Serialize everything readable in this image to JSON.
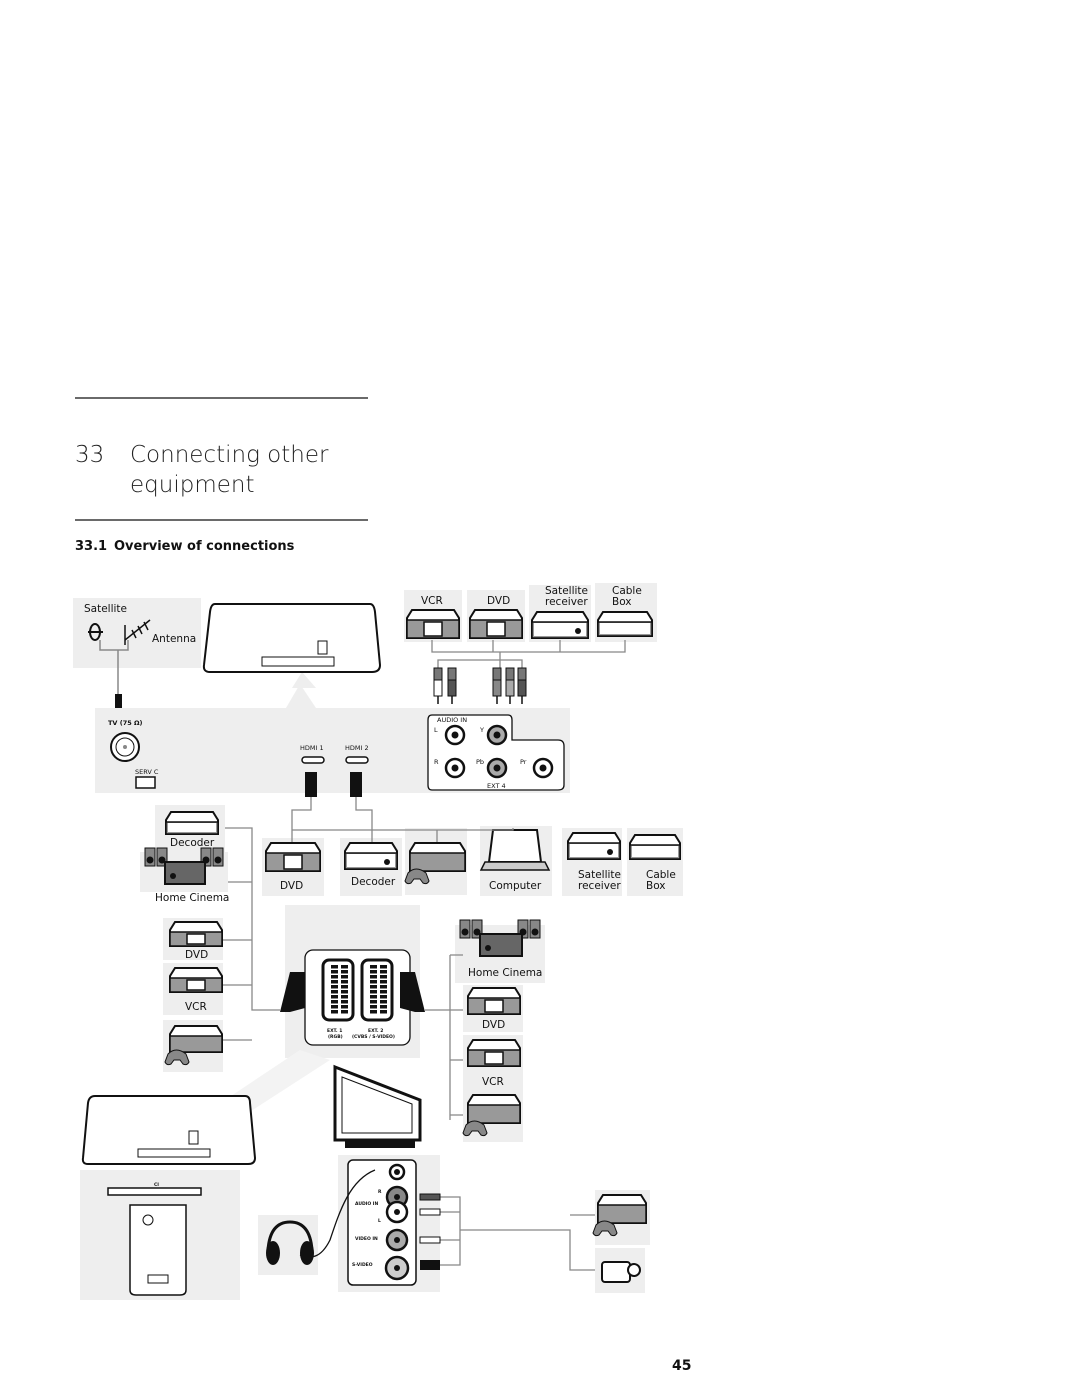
{
  "chapter": {
    "number": "33",
    "title_line1": "Connecting other",
    "title_line2": "equipment"
  },
  "section": {
    "number": "33.1",
    "title": "Overview of connections"
  },
  "diagram": {
    "antenna_box": {
      "satellite": "Satellite",
      "antenna": "Antenna"
    },
    "rear_panel": {
      "tv_port": "TV (75 Ω)",
      "serv_port": "SERV C",
      "hdmi1": "HDMI 1",
      "hdmi2": "HDMI 2"
    },
    "ext4": {
      "audio_in": "AUDIO IN",
      "l": "L",
      "r": "R",
      "y": "Y",
      "pb": "Pb",
      "pr": "Pr",
      "label": "EXT 4"
    },
    "top_devices": {
      "vcr": "VCR",
      "dvd": "DVD",
      "satellite1": "Satellite",
      "satellite2": "receiver",
      "cable1": "Cable",
      "cable2": "Box"
    },
    "left_devices": {
      "decoder": "Decoder",
      "home_cinema": "Home Cinema",
      "dvd": "DVD",
      "vcr": "VCR"
    },
    "hdmi_devices": {
      "dvd": "DVD",
      "decoder": "Decoder",
      "computer": "Computer",
      "satellite1": "Satellite",
      "satellite2": "receiver",
      "cable1": "Cable",
      "cable2": "Box"
    },
    "scart": {
      "ext1": "EXT. 1",
      "ext1_sub": "(RGB)",
      "ext2": "EXT. 2",
      "ext2_sub": "(CVBS / S-VIDEO)"
    },
    "right_devices": {
      "home_cinema": "Home Cinema",
      "dvd": "DVD",
      "vcr": "VCR"
    },
    "ci": {
      "label": "CI"
    },
    "side_panel": {
      "r": "R",
      "audio_in": "AUDIO IN",
      "l": "L",
      "video_in": "VIDEO IN",
      "svideo": "S-VIDEO"
    }
  },
  "page_number": "45"
}
